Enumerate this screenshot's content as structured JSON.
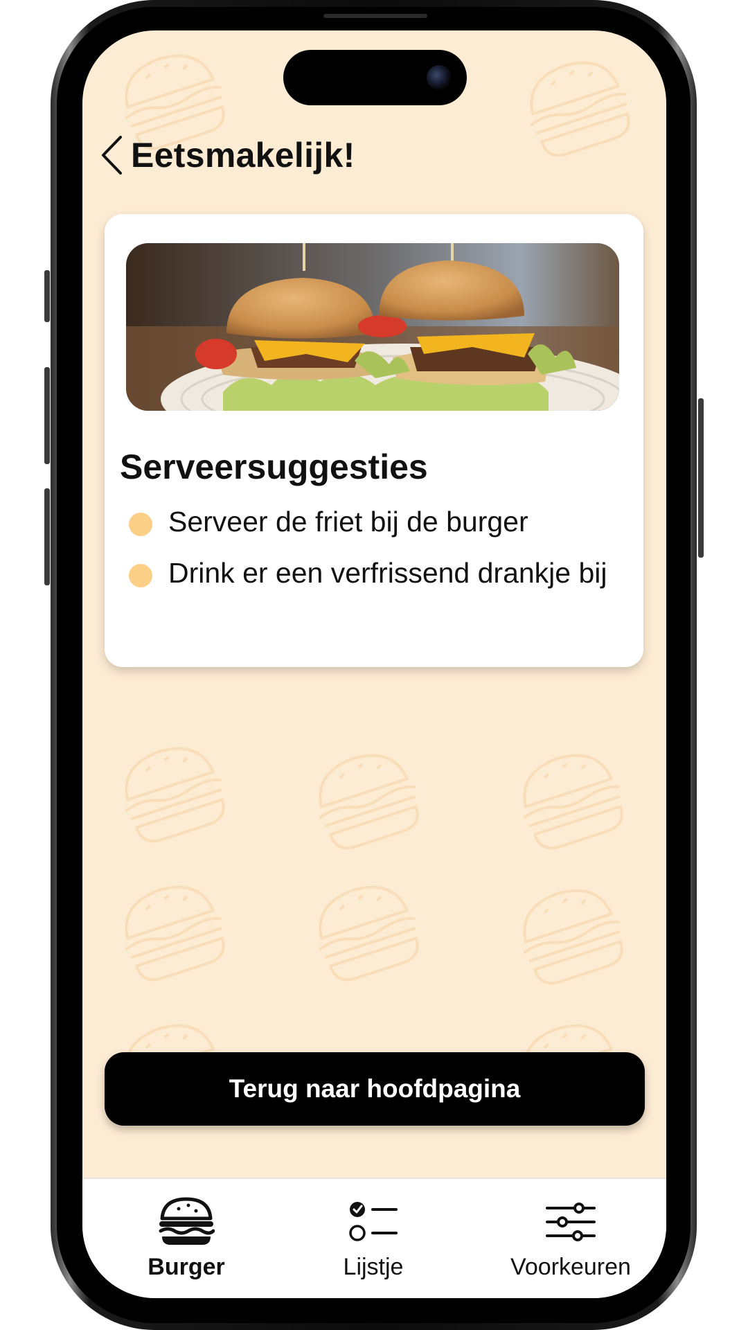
{
  "header": {
    "title": "Eetsmakelijk!",
    "back_icon": "chevron-left-icon"
  },
  "card": {
    "image": "burger-photo",
    "title": "Serveersuggesties",
    "suggestions": [
      "Serveer de friet bij de burger",
      "Drink er een verfrissend drankje bij"
    ]
  },
  "home_button": {
    "label": "Terug naar hoofdpagina"
  },
  "tabbar": {
    "tabs": [
      {
        "label": "Burger",
        "icon": "burger-icon",
        "active": true
      },
      {
        "label": "Lijstje",
        "icon": "checklist-icon",
        "active": false
      },
      {
        "label": "Voorkeuren",
        "icon": "sliders-icon",
        "active": false
      }
    ]
  },
  "colors": {
    "background": "#fdecd4",
    "card": "#ffffff",
    "bullet": "#fccf86",
    "button": "#000000",
    "pattern": "#f6d9ad"
  }
}
